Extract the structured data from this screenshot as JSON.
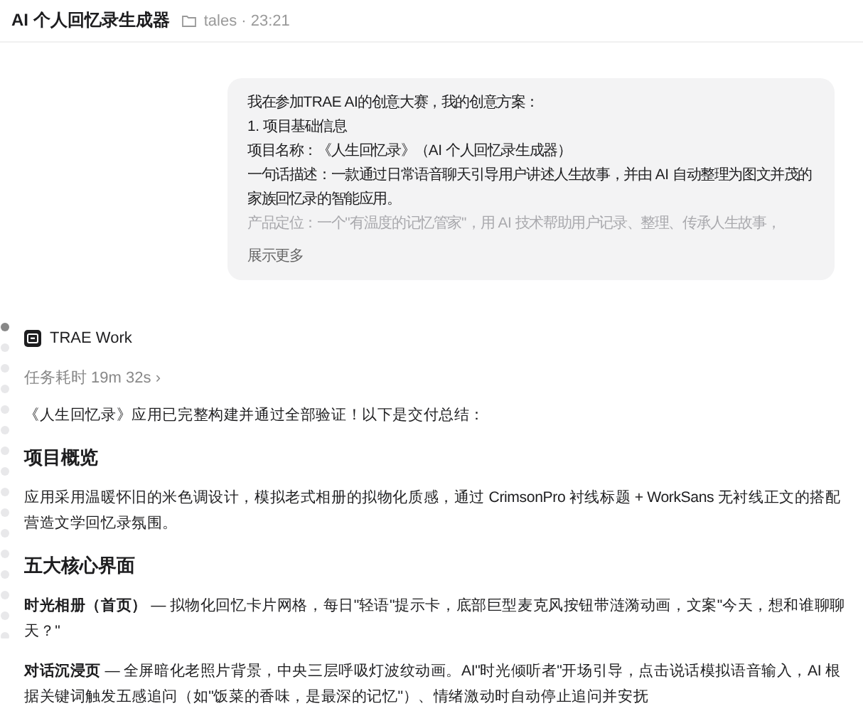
{
  "header": {
    "title": "AI 个人回忆录生成器",
    "folder": "tales",
    "separator": "·",
    "time": "23:21"
  },
  "user_message": {
    "lines": [
      "我在参加TRAE AI的创意大赛，我的创意方案：",
      "1. 项目基础信息",
      "项目名称：《人生回忆录》（AI 个人回忆录生成器）",
      "一句话描述：一款通过日常语音聊天引导用户讲述人生故事，并由 AI 自动整理为图文并茂的家族回忆录的智能应用。"
    ],
    "faded_line": "产品定位：一个\"有温度的记忆管家\"，用 AI 技术帮助用户记录、整理、传承人生故事，",
    "expand": "展示更多"
  },
  "assistant": {
    "name": "TRAE Work",
    "duration": "任务耗时 19m 32s",
    "duration_chevron": "›"
  },
  "response": [
    {
      "kind": "paragraph",
      "text": "《人生回忆录》应用已完整构建并通过全部验证！以下是交付总结："
    },
    {
      "kind": "heading",
      "text": "项目概览"
    },
    {
      "kind": "paragraph",
      "text": "应用采用温暖怀旧的米色调设计，模拟老式相册的拟物化质感，通过 CrimsonPro 衬线标题 + WorkSans 无衬线正文的搭配营造文学回忆录氛围。"
    },
    {
      "kind": "heading",
      "text": "五大核心界面"
    },
    {
      "kind": "paragraph",
      "text": "**时光相册（首页）** — 拟物化回忆卡片网格，每日\"轻语\"提示卡，底部巨型麦克风按钮带涟漪动画，文案\"今天，想和谁聊聊天？\""
    },
    {
      "kind": "paragraph",
      "text": "**对话沉浸页** — 全屏暗化老照片背景，中央三层呼吸灯波纹动画。AI\"时光倾听者\"开场引导，点击说话模拟语音输入，AI 根据关键词触发五感追问（如\"饭菜的香味，是最深的记忆\"）、情绪激动时自动停止追问并安抚"
    }
  ]
}
